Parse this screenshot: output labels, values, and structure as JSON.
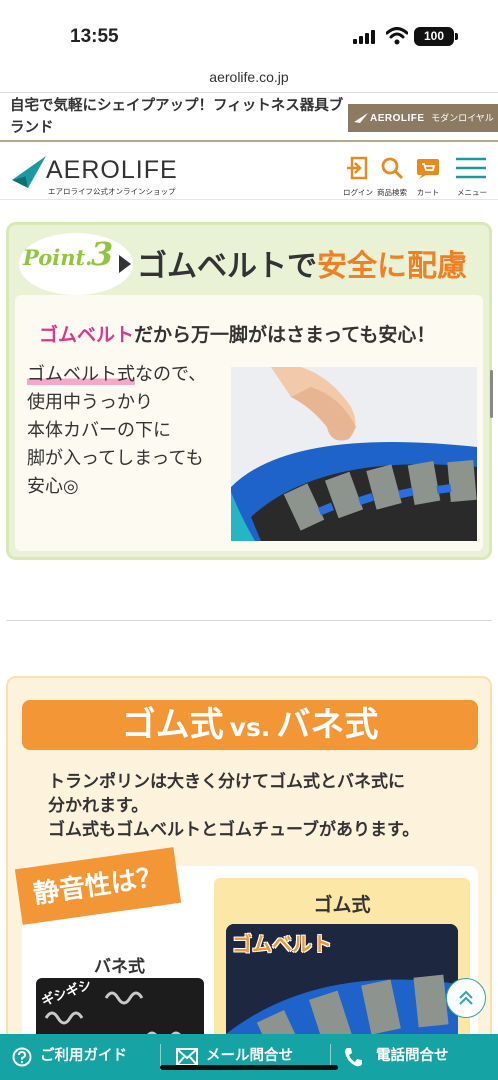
{
  "status_bar": {
    "time": "13:55",
    "battery": "100"
  },
  "browser": {
    "url": "aerolife.co.jp"
  },
  "banner": {
    "text": "自宅で気軽にシェイプアップ！フィットネス器具ブランド",
    "brand_name": "AEROLIFE",
    "brand_sub": "モダンロイヤル株式会社"
  },
  "header": {
    "logo_word": "AEROLIFE",
    "logo_sub": "エアロライフ公式オンラインショップ",
    "icons": [
      {
        "icon": "login-icon",
        "label": "ログイン"
      },
      {
        "icon": "search-icon",
        "label": "商品検索"
      },
      {
        "icon": "cart-icon",
        "label": "カート"
      },
      {
        "icon": "menu-icon",
        "label": "メニュー"
      }
    ]
  },
  "point3": {
    "point_label": "Point.",
    "point_num": "3",
    "title_a": "ゴムベルトで",
    "title_b": "安全に配慮",
    "lead_hl": "ゴムベルト",
    "lead_rest": "だから万一脚がはさまっても安心！",
    "body_ul": "ゴムベルト式",
    "body_rest": "なので、",
    "body_lines": [
      "使用中うっかり",
      "本体カバーの下に",
      "脚が入ってしまっても",
      "安心◎"
    ]
  },
  "comparison": {
    "title_a": "ゴム式",
    "title_vs": "vs.",
    "title_b": "バネ式",
    "intro_lines": [
      "トランポリンは大きく分けてゴム式とバネ式に",
      "分かれます。",
      "ゴム式もゴムベルトとゴムチューブがあります。"
    ],
    "quiet_tag": "静音性は？",
    "spring_label": "バネ式",
    "spring_caption": "ギシギシ",
    "rubber_label": "ゴム式",
    "rubber_caption": "ゴムベルト"
  },
  "footer": {
    "items": [
      {
        "icon": "help-icon",
        "label": "ご利用ガイド"
      },
      {
        "icon": "mail-icon",
        "label": "メール問合せ"
      },
      {
        "icon": "phone-icon",
        "label": "電話問合せ"
      }
    ]
  },
  "colors": {
    "teal": "#16a3a3",
    "orange": "#f39635",
    "green": "#8fc63d",
    "pink": "#e0358c"
  }
}
